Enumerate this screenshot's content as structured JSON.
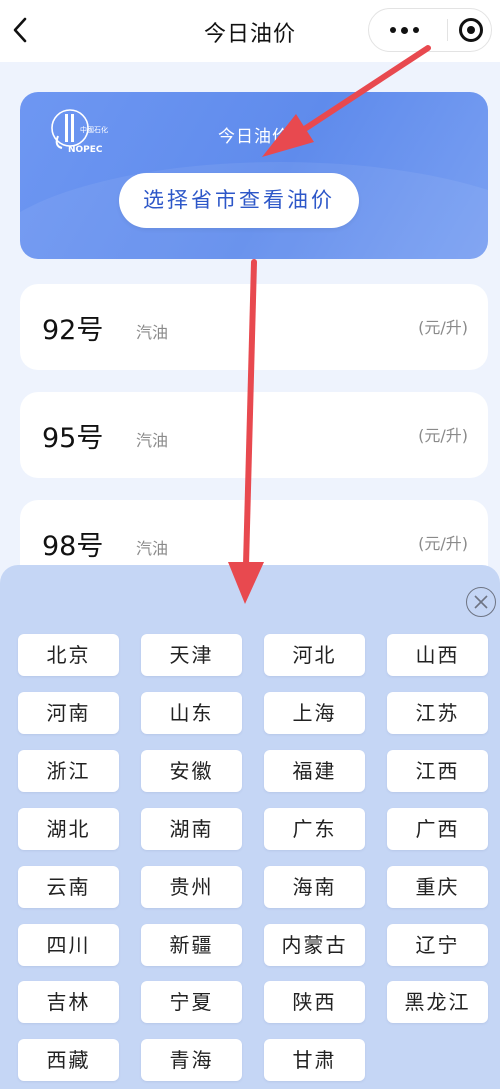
{
  "nav": {
    "title": "今日油价"
  },
  "banner": {
    "title": "今日油价",
    "button_label": "选择省市查看油价",
    "logo_text": "SINOPEC"
  },
  "prices": [
    {
      "grade": "92号",
      "kind": "汽油",
      "unit": "(元/升)"
    },
    {
      "grade": "95号",
      "kind": "汽油",
      "unit": "(元/升)"
    },
    {
      "grade": "98号",
      "kind": "汽油",
      "unit": "(元/升)"
    }
  ],
  "provinces": [
    "北京",
    "天津",
    "河北",
    "山西",
    "河南",
    "山东",
    "上海",
    "江苏",
    "浙江",
    "安徽",
    "福建",
    "江西",
    "湖北",
    "湖南",
    "广东",
    "广西",
    "云南",
    "贵州",
    "海南",
    "重庆",
    "四川",
    "新疆",
    "内蒙古",
    "辽宁",
    "吉林",
    "宁夏",
    "陕西",
    "黑龙江",
    "西藏",
    "青海",
    "甘肃"
  ],
  "colors": {
    "accent": "#5f8bec",
    "annotation_arrow": "#e8494f",
    "sheet_bg": "#c5d6f5"
  }
}
